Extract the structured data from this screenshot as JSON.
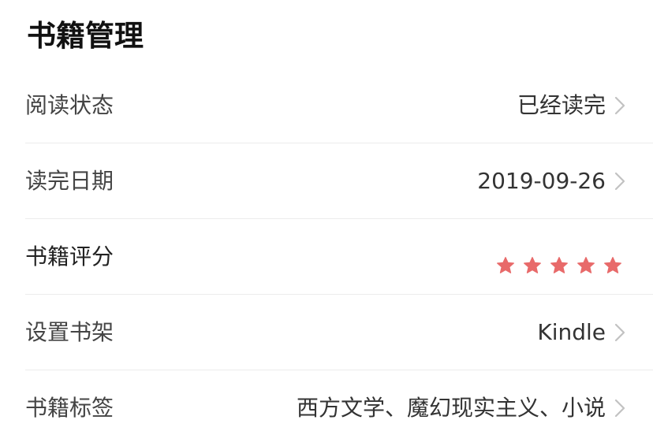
{
  "page": {
    "title": "书籍管理"
  },
  "rows": [
    {
      "label": "阅读状态",
      "value": "已经读完",
      "chevron": "chevron-right-icon"
    },
    {
      "label": "读完日期",
      "value": "2019-09-26",
      "chevron": "chevron-right-icon"
    },
    {
      "label": "书籍评分",
      "rating": 5,
      "rating_max": 5,
      "star_icon": "star-icon"
    },
    {
      "label": "设置书架",
      "value": "Kindle",
      "chevron": "chevron-right-icon"
    },
    {
      "label": "书籍标签",
      "value": "西方文学、魔幻现实主义、小说",
      "chevron": "chevron-right-icon"
    }
  ],
  "colors": {
    "star": "#e86a6a",
    "chevron": "#c2c2c2",
    "divider": "#ececec",
    "label": "#444444",
    "value": "#333333",
    "title": "#111111"
  }
}
